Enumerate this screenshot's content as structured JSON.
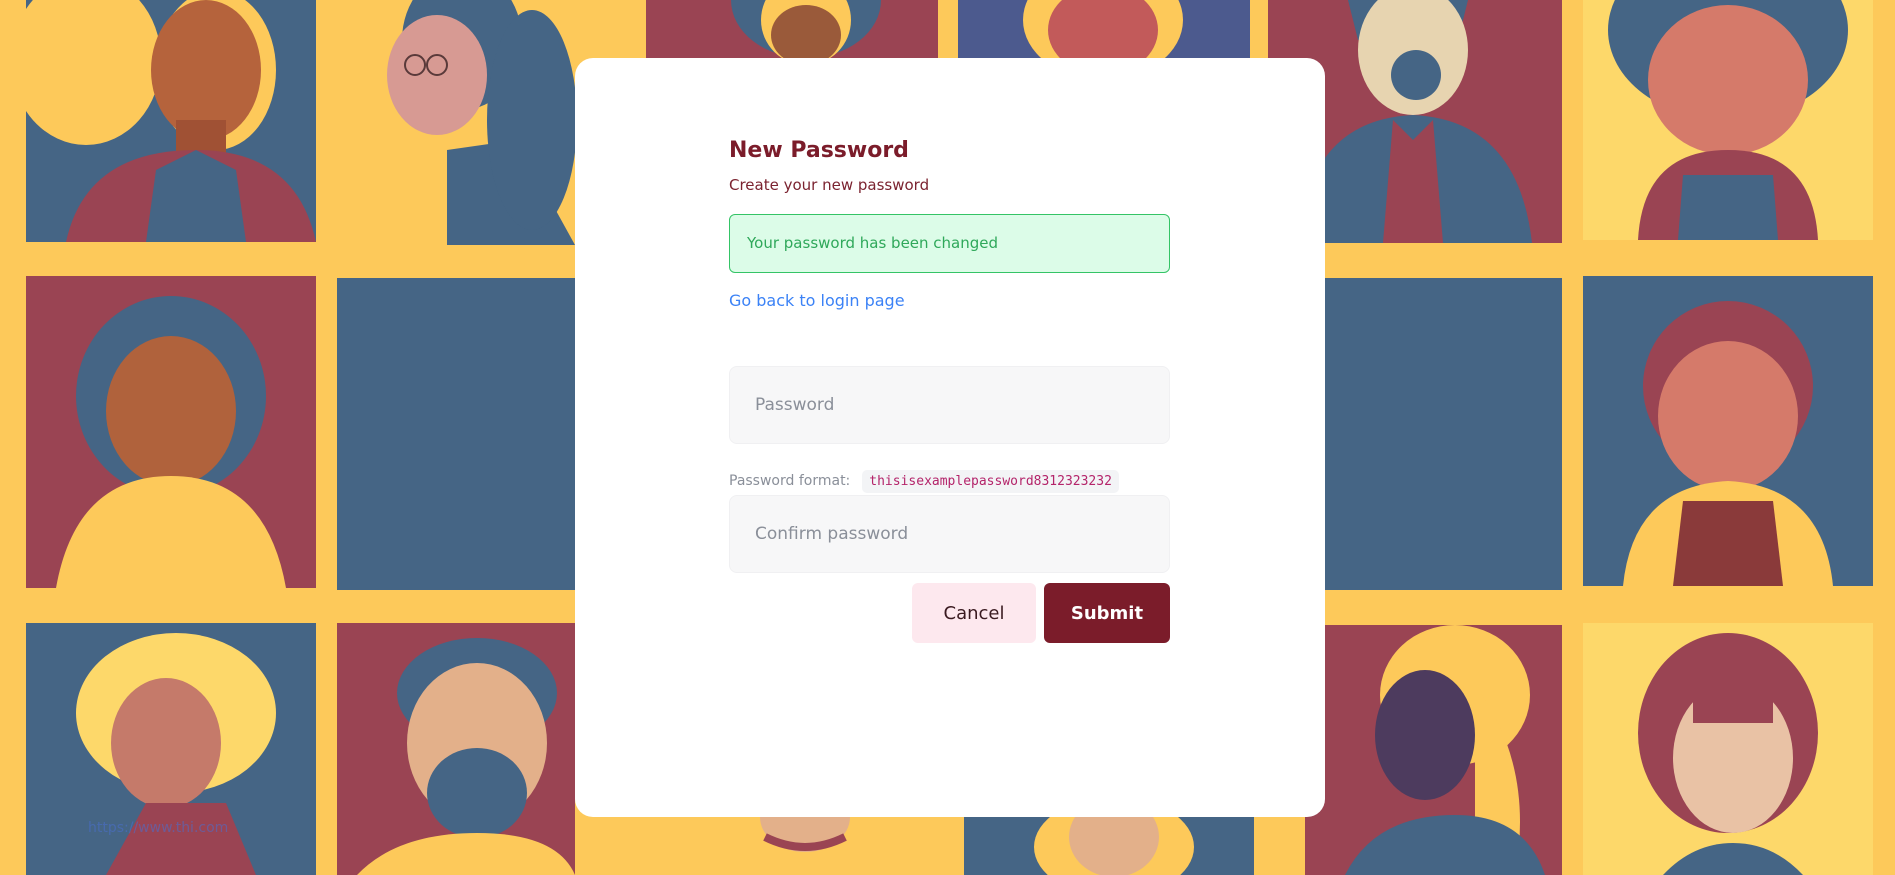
{
  "page": {
    "title": "New Password",
    "subtitle": "Create your new password",
    "alert": "Your password has been changed",
    "back_link": "Go back to login page"
  },
  "form": {
    "password_placeholder": "Password",
    "format_label": "Password format:",
    "format_example": "thisisexamplepassword8312323232",
    "confirm_placeholder": "Confirm password",
    "cancel_label": "Cancel",
    "submit_label": "Submit"
  },
  "background": {
    "watermark": "https://www.thi.com"
  },
  "colors": {
    "brand": "#7b1c2a",
    "success_bg": "#dcfce8",
    "success_border": "#34c466",
    "link": "#3b82f6",
    "mural_yellow": "#fdc95a",
    "mural_blue": "#456585",
    "mural_red": "#9a4453"
  }
}
